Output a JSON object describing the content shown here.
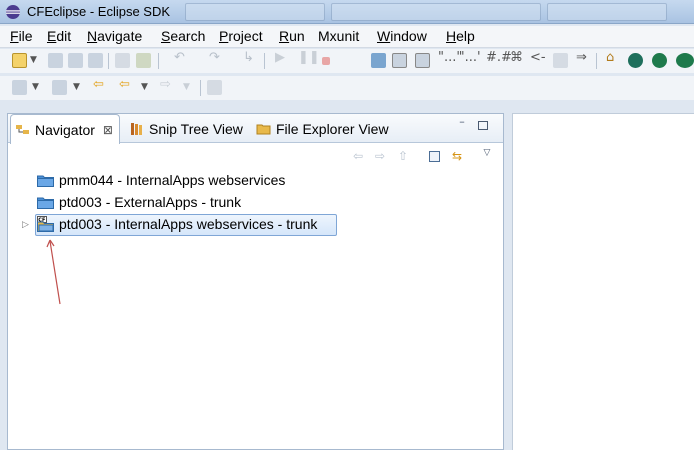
{
  "window": {
    "title": "CFEclipse - Eclipse SDK"
  },
  "menu": {
    "items": [
      {
        "first": "F",
        "rest": "ile"
      },
      {
        "first": "E",
        "rest": "dit"
      },
      {
        "first": "N",
        "rest": "avigate"
      },
      {
        "first": "S",
        "rest": "earch"
      },
      {
        "first": "P",
        "rest": "roject"
      },
      {
        "first": "R",
        "rest": "un"
      },
      {
        "first": "",
        "rest": "Mxunit"
      },
      {
        "first": "W",
        "rest": "indow"
      },
      {
        "first": "H",
        "rest": "elp"
      }
    ]
  },
  "view_tabs": {
    "navigator": "Navigator",
    "snip_tree": "Snip Tree View",
    "file_explorer": "File Explorer View",
    "close_glyph": "⊠"
  },
  "tree": {
    "items": [
      {
        "label": "pmm044 - InternalApps webservices"
      },
      {
        "label": "ptd003 - ExternalApps - trunk"
      },
      {
        "label": "ptd003 - InternalApps webservices - trunk"
      }
    ]
  },
  "colors": {
    "folder": "#4a8fd6",
    "annotation_arrow": "#c0504d",
    "selection_border": "#7fa6d6"
  },
  "icons": {
    "app": "eclipse-icon",
    "cfeclipse_project": "cf-project-icon",
    "folder": "folder-icon"
  }
}
